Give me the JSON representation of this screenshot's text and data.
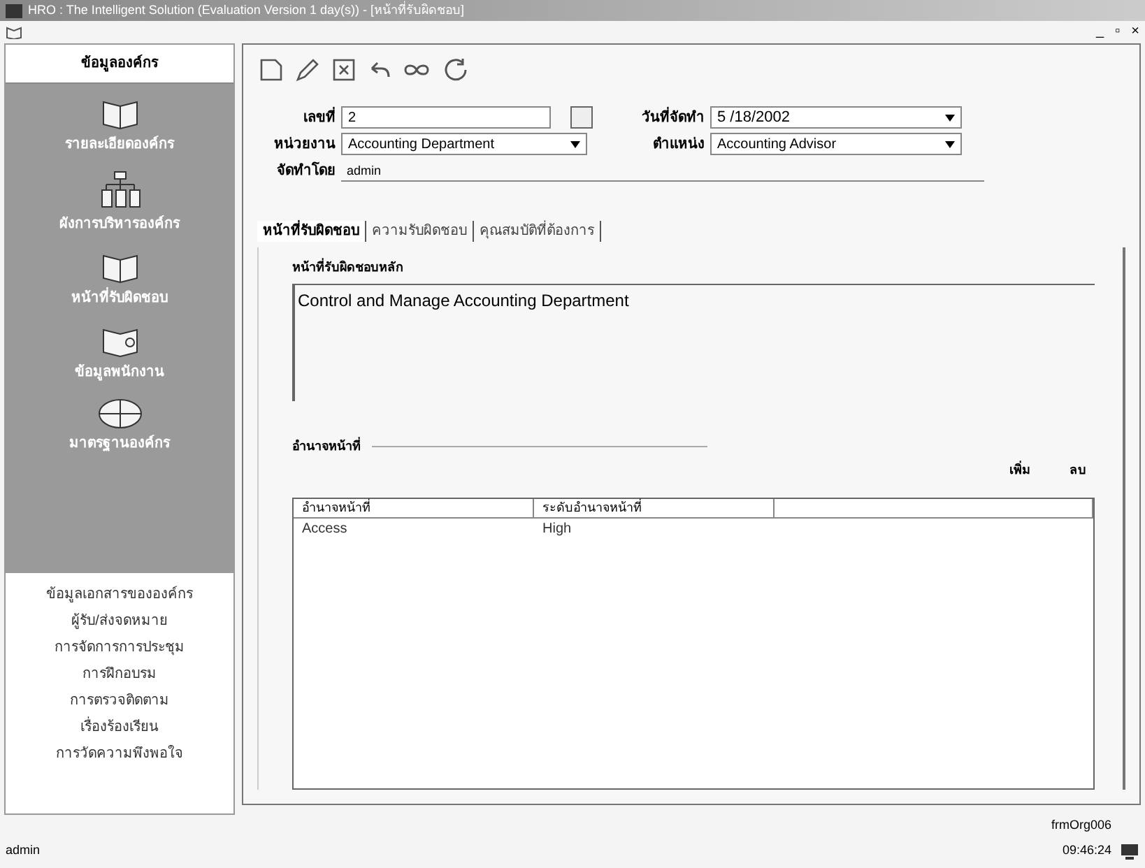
{
  "window": {
    "title": "HRO : The Intelligent Solution (Evaluation Version 1 day(s)) - [หน้าที่รับผิดชอบ]",
    "controls": [
      "_",
      "▫",
      "×"
    ]
  },
  "sidebar": {
    "header": "ข้อมูลองค์กร",
    "items": [
      {
        "label": "รายละเอียดองค์กร"
      },
      {
        "label": "ผังการบริหารองค์กร"
      },
      {
        "label": "หน้าที่รับผิดชอบ"
      },
      {
        "label": "ข้อมูลพนักงาน"
      },
      {
        "label": "มาตรฐานองค์กร"
      }
    ],
    "links": [
      "ข้อมูลเอกสารขององค์กร",
      "ผู้รับ/ส่งจดหมาย",
      "การจัดการการประชุม",
      "การฝึกอบรม",
      "การตรวจติดตาม",
      "เรื่องร้องเรียน",
      "การวัดความพึงพอใจ"
    ]
  },
  "form": {
    "number": {
      "label": "เลขที่",
      "value": "2"
    },
    "department": {
      "label": "หน่วยงาน",
      "value": "Accounting Department"
    },
    "created_by": {
      "label": "จัดทำโดย",
      "value": "admin"
    },
    "date": {
      "label": "วันที่จัดทำ",
      "value": "5 /18/2002"
    },
    "position": {
      "label": "ตำแหน่ง",
      "value": "Accounting Advisor"
    }
  },
  "tabs": [
    {
      "label": "หน้าที่รับผิดชอบ",
      "selected": true
    },
    {
      "label": "ความรับผิดชอบ",
      "selected": false
    },
    {
      "label": "คุณสมบัติที่ต้องการ",
      "selected": false
    }
  ],
  "main_duty": {
    "label": "หน้าที่รับผิดชอบหลัก",
    "value": "Control and Manage Accounting Department"
  },
  "authority": {
    "label": "อำนาจหน้าที่",
    "buttons": [
      "เพิ่ม",
      "ลบ"
    ],
    "columns": [
      "อำนาจหน้าที่",
      "ระดับอำนาจหน้าที่"
    ],
    "rows": [
      [
        "Access",
        "High"
      ]
    ]
  },
  "status_bar": {
    "user": "admin",
    "form": "frmOrg006",
    "time": "09:46:24"
  }
}
